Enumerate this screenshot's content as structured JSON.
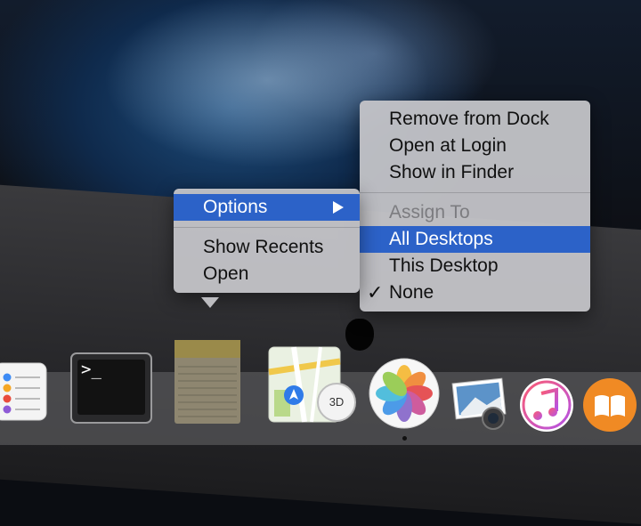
{
  "main_menu": {
    "items": [
      {
        "label": "Options"
      },
      {
        "label": "Show Recents"
      },
      {
        "label": "Open"
      }
    ]
  },
  "sub_menu": {
    "items": [
      {
        "label": "Remove from Dock"
      },
      {
        "label": "Open at Login"
      },
      {
        "label": "Show in Finder"
      },
      {
        "label": "Assign To"
      },
      {
        "label": "All Desktops"
      },
      {
        "label": "This Desktop"
      },
      {
        "label": "None"
      }
    ],
    "checkmark": "✓"
  },
  "dock": {
    "apps": [
      {
        "icon": "reminders-icon"
      },
      {
        "icon": "terminal-icon",
        "prompt": ">_"
      },
      {
        "icon": "notes-icon"
      },
      {
        "icon": "maps-icon",
        "badge": "3D"
      },
      {
        "icon": "photos-icon"
      },
      {
        "icon": "iphoto-icon"
      },
      {
        "icon": "itunes-icon"
      },
      {
        "icon": "ibooks-icon"
      }
    ]
  },
  "colors": {
    "selection": "#2c62c8",
    "menu_bg": "#c4c4c8"
  }
}
